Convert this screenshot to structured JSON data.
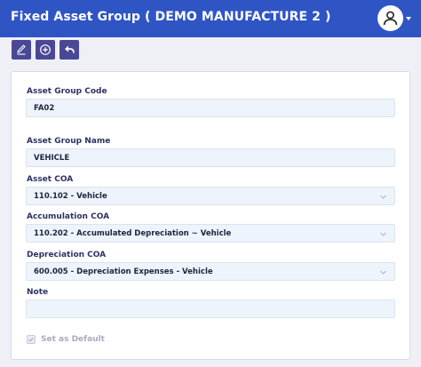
{
  "header": {
    "title": "Fixed Asset Group ( DEMO MANUFACTURE 2 )"
  },
  "toolbar": {
    "buttons": [
      {
        "icon": "edit-icon"
      },
      {
        "icon": "add-circle-icon"
      },
      {
        "icon": "undo-icon"
      }
    ]
  },
  "form": {
    "asset_group_code": {
      "label": "Asset Group Code",
      "value": "FA02"
    },
    "asset_group_name": {
      "label": "Asset Group Name",
      "value": "VEHICLE"
    },
    "asset_coa": {
      "label": "Asset COA",
      "value": "110.102 - Vehicle"
    },
    "accumulation_coa": {
      "label": "Accumulation COA",
      "value": "110.202 - Accumulated Depreciation ~ Vehicle"
    },
    "depreciation_coa": {
      "label": "Depreciation COA",
      "value": "600.005 - Depreciation Expenses - Vehicle"
    },
    "note": {
      "label": "Note",
      "value": ""
    },
    "set_default": {
      "label": "Set as Default",
      "checked": true
    }
  },
  "colors": {
    "header": "#2f55c4",
    "toolbar_button": "#4a4895",
    "label": "#2d3163",
    "field_bg": "#eef4fb"
  }
}
